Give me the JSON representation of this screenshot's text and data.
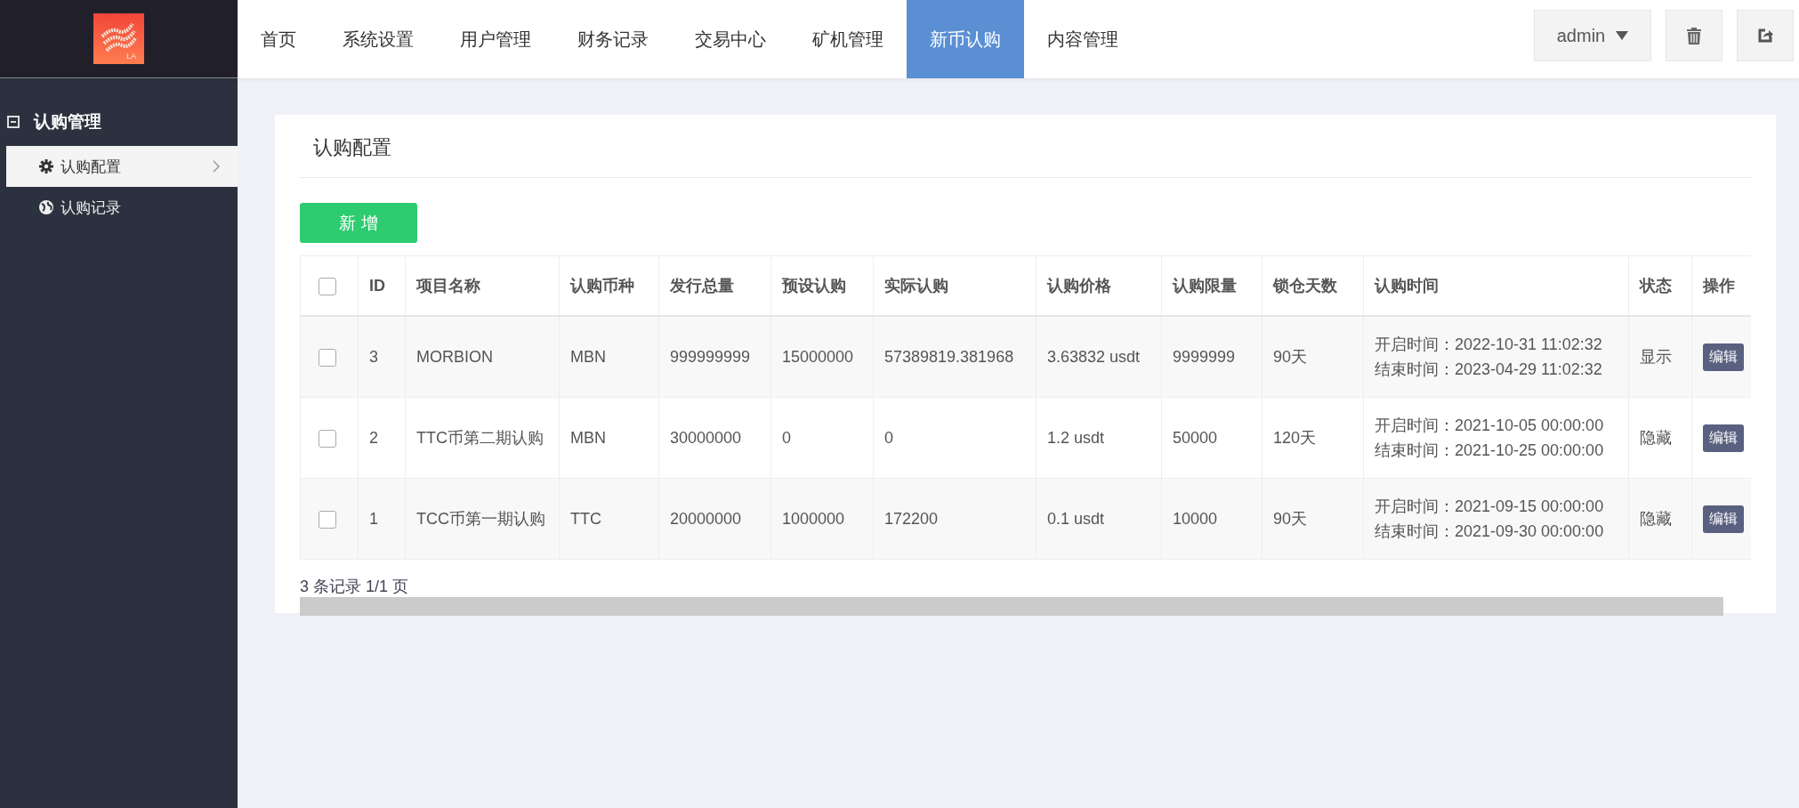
{
  "logo": {
    "text": "LA"
  },
  "nav": [
    {
      "label": "首页",
      "selected": false
    },
    {
      "label": "系统设置",
      "selected": false
    },
    {
      "label": "用户管理",
      "selected": false
    },
    {
      "label": "财务记录",
      "selected": false
    },
    {
      "label": "交易中心",
      "selected": false
    },
    {
      "label": "矿机管理",
      "selected": false
    },
    {
      "label": "新币认购",
      "selected": true
    },
    {
      "label": "内容管理",
      "selected": false
    }
  ],
  "user_menu": {
    "label": "admin"
  },
  "sidebar": {
    "group": {
      "label": "认购管理",
      "expanded": true
    },
    "items": [
      {
        "label": "认购配置",
        "kind": "gear",
        "selected": true
      },
      {
        "label": "认购记录",
        "kind": "globe",
        "selected": false
      }
    ]
  },
  "page_title": "认购配置",
  "add_button": "新 增",
  "table": {
    "header_checked": false,
    "columns": [
      "ID",
      "项目名称",
      "认购币种",
      "发行总量",
      "预设认购",
      "实际认购",
      "认购价格",
      "认购限量",
      "锁仓天数",
      "认购时间",
      "状态",
      "操作"
    ],
    "rows": [
      {
        "checked": false,
        "cells": [
          "3",
          "MORBION",
          "MBN",
          "999999999",
          "15000000",
          "57389819.381968",
          "3.63832 usdt",
          "9999999",
          "90天"
        ],
        "start": "开启时间：2022-10-31 11:02:32",
        "end": "结束时间：2023-04-29 11:02:32",
        "status": "显示",
        "action": "编辑"
      },
      {
        "checked": false,
        "cells": [
          "2",
          "TTC币第二期认购",
          "MBN",
          "30000000",
          "0",
          "0",
          "1.2 usdt",
          "50000",
          "120天"
        ],
        "start": "开启时间：2021-10-05 00:00:00",
        "end": "结束时间：2021-10-25 00:00:00",
        "status": "隐藏",
        "action": "编辑"
      },
      {
        "checked": false,
        "cells": [
          "1",
          "TCC币第一期认购",
          "TTC",
          "20000000",
          "1000000",
          "172200",
          "0.1 usdt",
          "10000",
          "90天"
        ],
        "start": "开启时间：2021-09-15 00:00:00",
        "end": "结束时间：2021-09-30 00:00:00",
        "status": "隐藏",
        "action": "编辑"
      }
    ]
  },
  "pagination": "3 条记录 1/1 页"
}
